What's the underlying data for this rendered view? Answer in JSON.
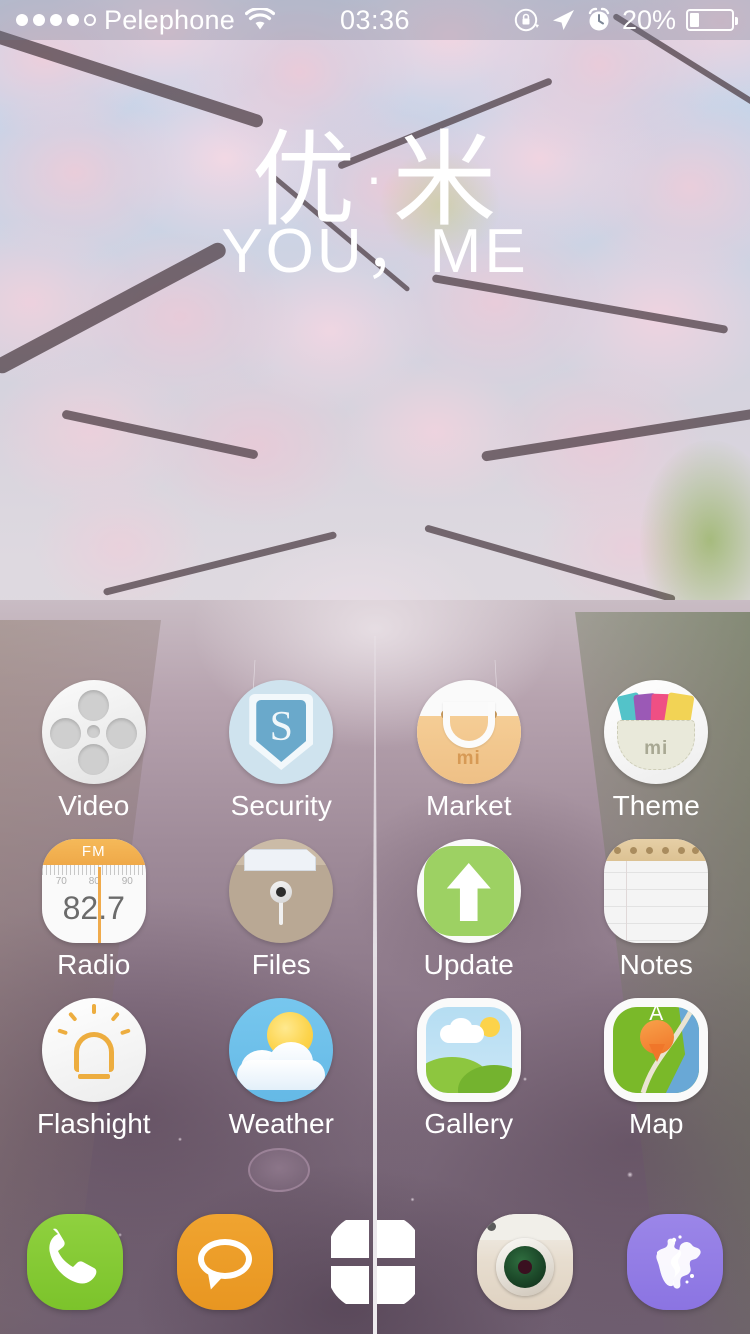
{
  "status_bar": {
    "carrier": "Pelephone",
    "signal_filled_dots": 4,
    "signal_empty_dots": 1,
    "wifi_icon": "wifi-icon",
    "time": "03:36",
    "rotation_lock_icon": "rotation-lock-icon",
    "location_icon": "location-arrow-icon",
    "alarm_icon": "alarm-clock-icon",
    "battery_percent": "20%",
    "battery_level": 20
  },
  "wallpaper": {
    "brand_cn": "优·米",
    "brand_en": "YOU，ME",
    "scene": "cherry-blossom-road"
  },
  "apps": [
    [
      {
        "label": "Video",
        "icon": "film-reel-icon"
      },
      {
        "label": "Security",
        "icon": "shield-icon",
        "badge_letter": "S"
      },
      {
        "label": "Market",
        "icon": "shopping-bag-icon",
        "brand": "mi"
      },
      {
        "label": "Theme",
        "icon": "theme-pocket-icon",
        "brand": "mi"
      }
    ],
    [
      {
        "label": "Radio",
        "icon": "fm-radio-icon",
        "band": "FM",
        "frequency": "82.7",
        "scale": [
          "70",
          "80",
          "90"
        ]
      },
      {
        "label": "Files",
        "icon": "folder-pin-icon"
      },
      {
        "label": "Update",
        "icon": "up-arrow-icon"
      },
      {
        "label": "Notes",
        "icon": "notepad-icon"
      }
    ],
    [
      {
        "label": "Flashight",
        "icon": "lightbulb-icon"
      },
      {
        "label": "Weather",
        "icon": "sun-cloud-icon"
      },
      {
        "label": "Gallery",
        "icon": "landscape-photo-icon"
      },
      {
        "label": "Map",
        "icon": "map-pin-icon",
        "pin_letter": "A"
      }
    ]
  ],
  "dock": [
    {
      "label": "Phone",
      "icon": "phone-handset-icon"
    },
    {
      "label": "Messages",
      "icon": "speech-bubble-icon"
    },
    {
      "label": "App Drawer",
      "icon": "grid-squares-icon"
    },
    {
      "label": "Camera",
      "icon": "camera-lens-icon"
    },
    {
      "label": "Browser",
      "icon": "globe-icon"
    }
  ],
  "colors": {
    "security_blue": "#6aa9cb",
    "market_tan": "#eec086",
    "update_green": "#9dd163",
    "radio_orange": "#efa949",
    "weather_blue": "#65b9e6",
    "map_green": "#7ab929",
    "map_pin_orange": "#f0762a",
    "phone_green": "#7cc32b",
    "messages_orange": "#e89621",
    "browser_purple": "#8b74e2",
    "label_text": "#ffffff"
  }
}
